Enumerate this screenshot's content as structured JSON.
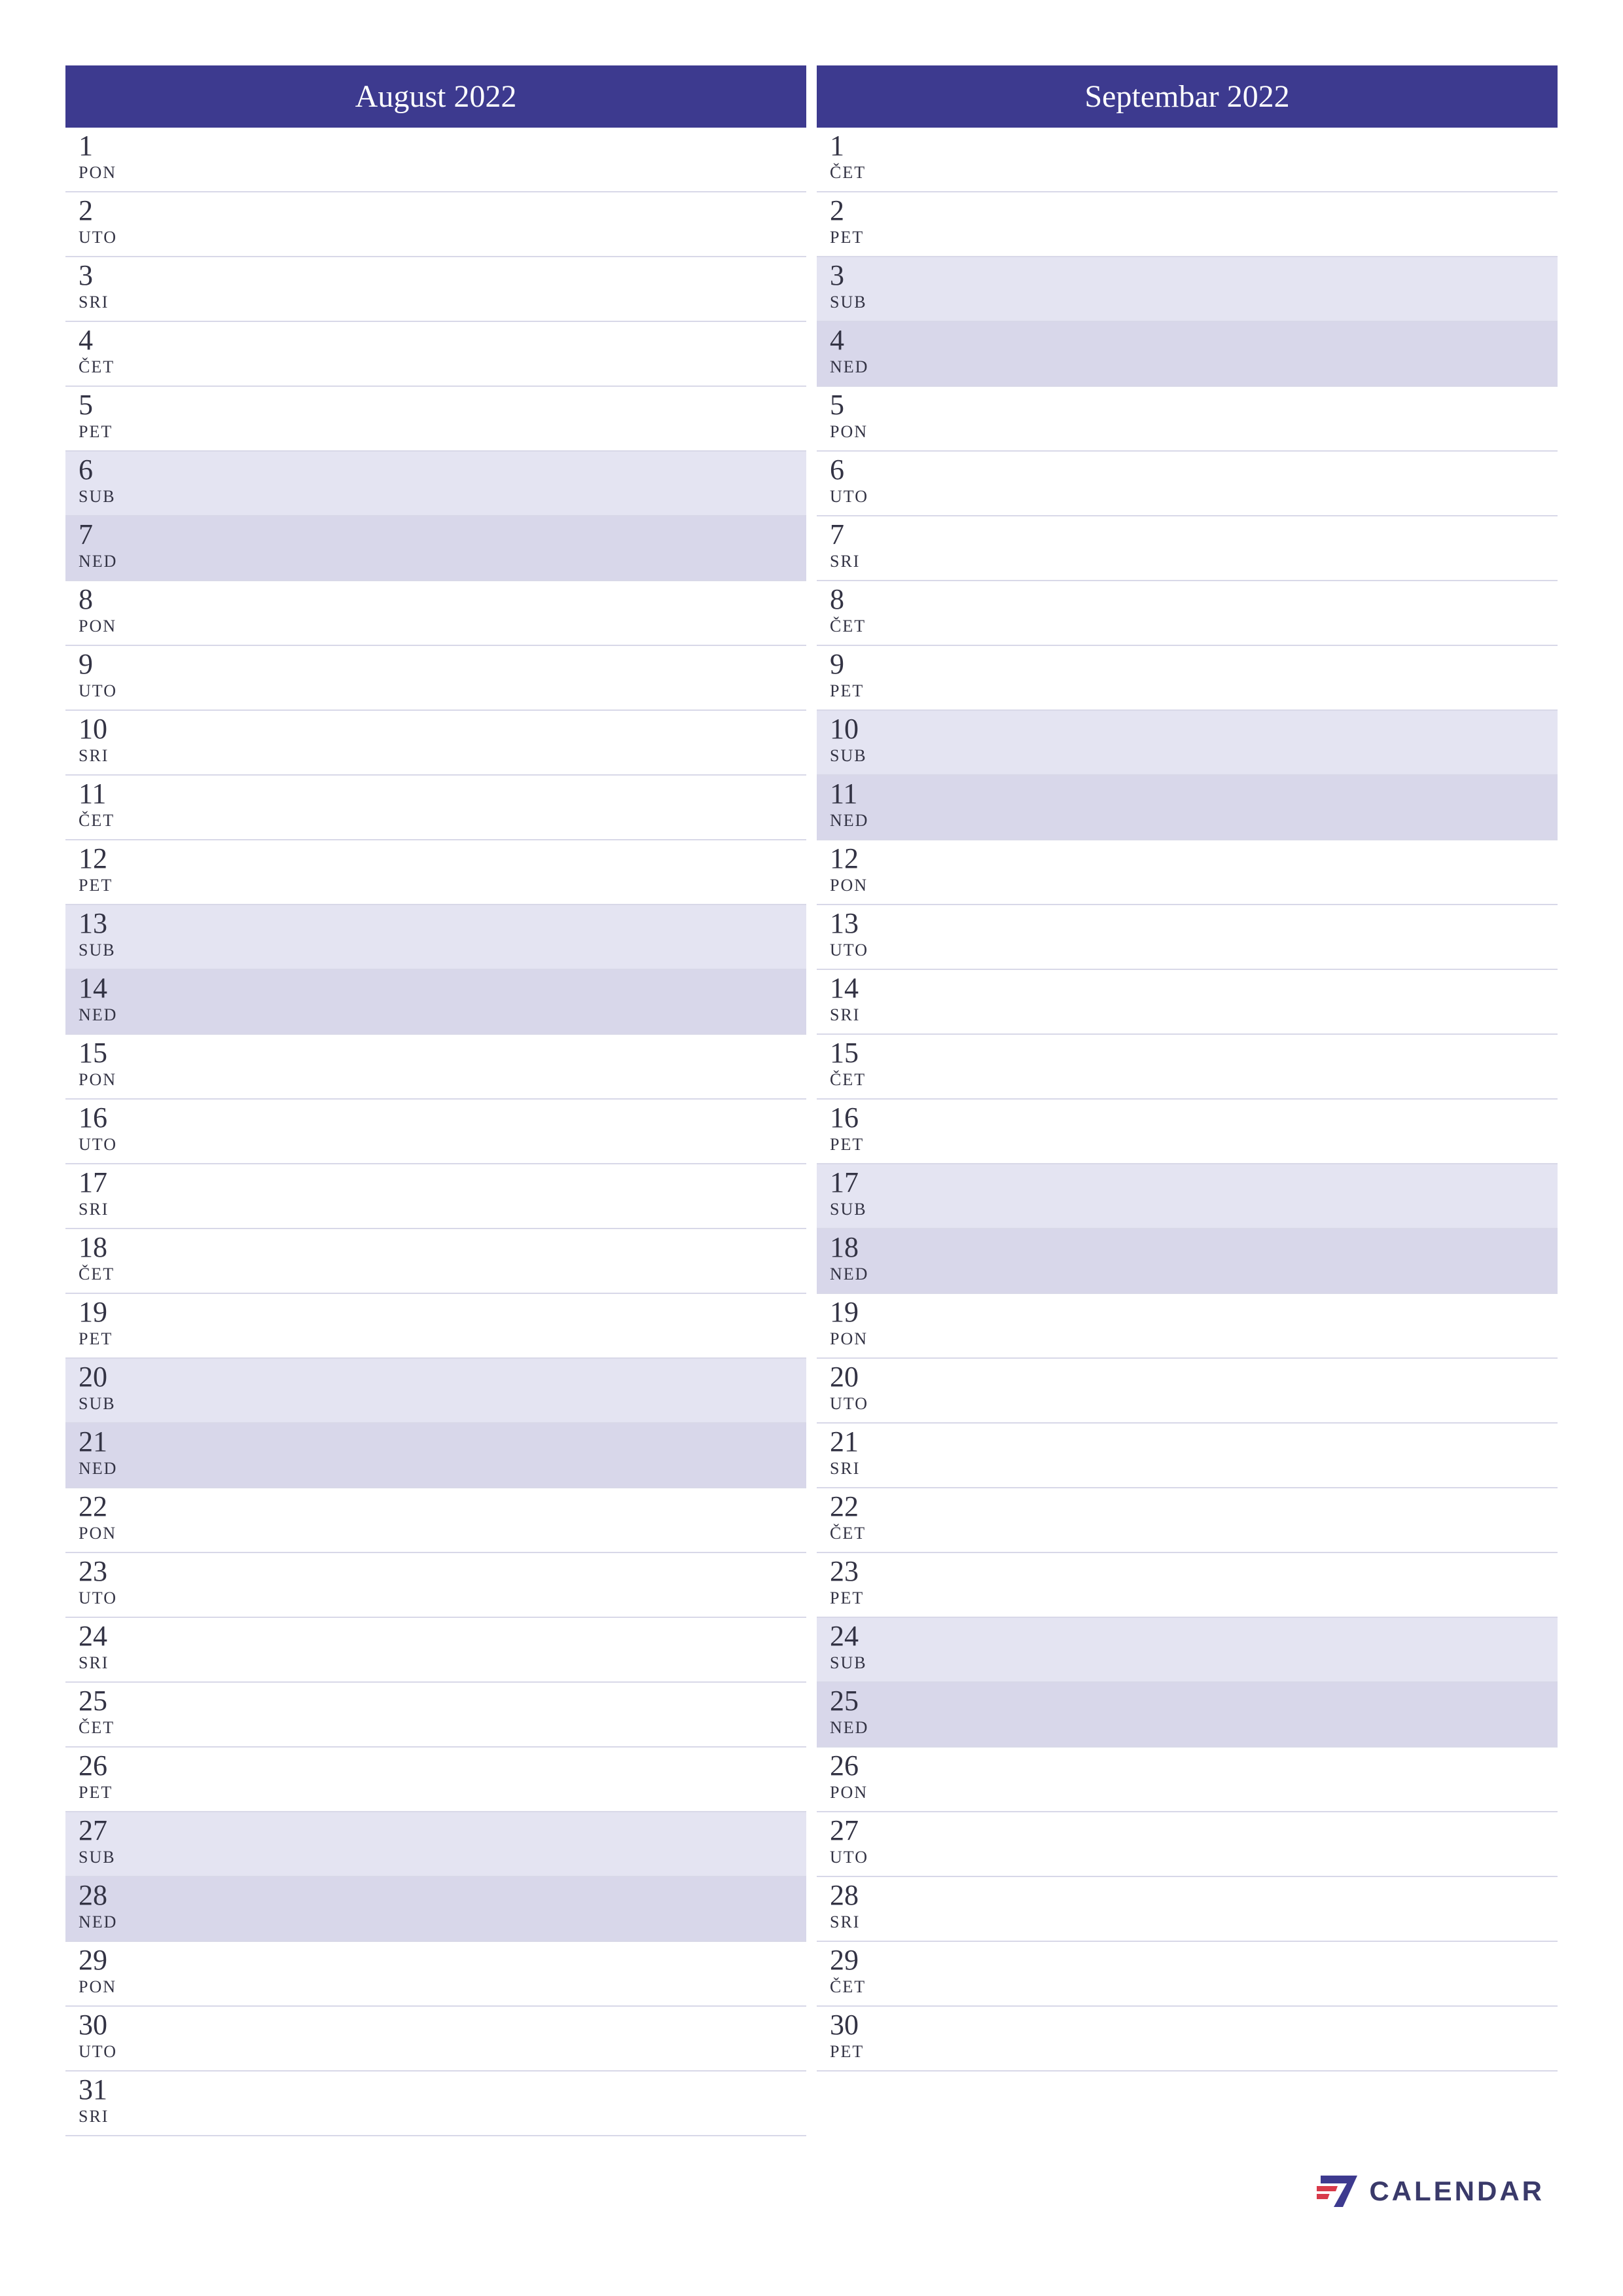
{
  "colors": {
    "header_bg": "#3d3a8f",
    "header_text": "#ffffff",
    "weekday_bg": "#ffffff",
    "saturday_bg": "#e4e4f2",
    "sunday_bg": "#d8d7ea",
    "border": "#d8d8e8"
  },
  "day_abbr": {
    "mon": "PON",
    "tue": "UTO",
    "wed": "SRI",
    "thu": "ČET",
    "fri": "PET",
    "sat": "SUB",
    "sun": "NED"
  },
  "months": [
    {
      "title": "August 2022",
      "days": [
        {
          "num": "1",
          "abbr": "PON",
          "type": "weekday"
        },
        {
          "num": "2",
          "abbr": "UTO",
          "type": "weekday"
        },
        {
          "num": "3",
          "abbr": "SRI",
          "type": "weekday"
        },
        {
          "num": "4",
          "abbr": "ČET",
          "type": "weekday"
        },
        {
          "num": "5",
          "abbr": "PET",
          "type": "weekday"
        },
        {
          "num": "6",
          "abbr": "SUB",
          "type": "saturday"
        },
        {
          "num": "7",
          "abbr": "NED",
          "type": "sunday"
        },
        {
          "num": "8",
          "abbr": "PON",
          "type": "weekday"
        },
        {
          "num": "9",
          "abbr": "UTO",
          "type": "weekday"
        },
        {
          "num": "10",
          "abbr": "SRI",
          "type": "weekday"
        },
        {
          "num": "11",
          "abbr": "ČET",
          "type": "weekday"
        },
        {
          "num": "12",
          "abbr": "PET",
          "type": "weekday"
        },
        {
          "num": "13",
          "abbr": "SUB",
          "type": "saturday"
        },
        {
          "num": "14",
          "abbr": "NED",
          "type": "sunday"
        },
        {
          "num": "15",
          "abbr": "PON",
          "type": "weekday"
        },
        {
          "num": "16",
          "abbr": "UTO",
          "type": "weekday"
        },
        {
          "num": "17",
          "abbr": "SRI",
          "type": "weekday"
        },
        {
          "num": "18",
          "abbr": "ČET",
          "type": "weekday"
        },
        {
          "num": "19",
          "abbr": "PET",
          "type": "weekday"
        },
        {
          "num": "20",
          "abbr": "SUB",
          "type": "saturday"
        },
        {
          "num": "21",
          "abbr": "NED",
          "type": "sunday"
        },
        {
          "num": "22",
          "abbr": "PON",
          "type": "weekday"
        },
        {
          "num": "23",
          "abbr": "UTO",
          "type": "weekday"
        },
        {
          "num": "24",
          "abbr": "SRI",
          "type": "weekday"
        },
        {
          "num": "25",
          "abbr": "ČET",
          "type": "weekday"
        },
        {
          "num": "26",
          "abbr": "PET",
          "type": "weekday"
        },
        {
          "num": "27",
          "abbr": "SUB",
          "type": "saturday"
        },
        {
          "num": "28",
          "abbr": "NED",
          "type": "sunday"
        },
        {
          "num": "29",
          "abbr": "PON",
          "type": "weekday"
        },
        {
          "num": "30",
          "abbr": "UTO",
          "type": "weekday"
        },
        {
          "num": "31",
          "abbr": "SRI",
          "type": "weekday"
        }
      ]
    },
    {
      "title": "Septembar 2022",
      "days": [
        {
          "num": "1",
          "abbr": "ČET",
          "type": "weekday"
        },
        {
          "num": "2",
          "abbr": "PET",
          "type": "weekday"
        },
        {
          "num": "3",
          "abbr": "SUB",
          "type": "saturday"
        },
        {
          "num": "4",
          "abbr": "NED",
          "type": "sunday"
        },
        {
          "num": "5",
          "abbr": "PON",
          "type": "weekday"
        },
        {
          "num": "6",
          "abbr": "UTO",
          "type": "weekday"
        },
        {
          "num": "7",
          "abbr": "SRI",
          "type": "weekday"
        },
        {
          "num": "8",
          "abbr": "ČET",
          "type": "weekday"
        },
        {
          "num": "9",
          "abbr": "PET",
          "type": "weekday"
        },
        {
          "num": "10",
          "abbr": "SUB",
          "type": "saturday"
        },
        {
          "num": "11",
          "abbr": "NED",
          "type": "sunday"
        },
        {
          "num": "12",
          "abbr": "PON",
          "type": "weekday"
        },
        {
          "num": "13",
          "abbr": "UTO",
          "type": "weekday"
        },
        {
          "num": "14",
          "abbr": "SRI",
          "type": "weekday"
        },
        {
          "num": "15",
          "abbr": "ČET",
          "type": "weekday"
        },
        {
          "num": "16",
          "abbr": "PET",
          "type": "weekday"
        },
        {
          "num": "17",
          "abbr": "SUB",
          "type": "saturday"
        },
        {
          "num": "18",
          "abbr": "NED",
          "type": "sunday"
        },
        {
          "num": "19",
          "abbr": "PON",
          "type": "weekday"
        },
        {
          "num": "20",
          "abbr": "UTO",
          "type": "weekday"
        },
        {
          "num": "21",
          "abbr": "SRI",
          "type": "weekday"
        },
        {
          "num": "22",
          "abbr": "ČET",
          "type": "weekday"
        },
        {
          "num": "23",
          "abbr": "PET",
          "type": "weekday"
        },
        {
          "num": "24",
          "abbr": "SUB",
          "type": "saturday"
        },
        {
          "num": "25",
          "abbr": "NED",
          "type": "sunday"
        },
        {
          "num": "26",
          "abbr": "PON",
          "type": "weekday"
        },
        {
          "num": "27",
          "abbr": "UTO",
          "type": "weekday"
        },
        {
          "num": "28",
          "abbr": "SRI",
          "type": "weekday"
        },
        {
          "num": "29",
          "abbr": "ČET",
          "type": "weekday"
        },
        {
          "num": "30",
          "abbr": "PET",
          "type": "weekday"
        },
        {
          "num": "",
          "abbr": "",
          "type": "empty"
        }
      ]
    }
  ],
  "footer": {
    "brand": "CALENDAR"
  }
}
